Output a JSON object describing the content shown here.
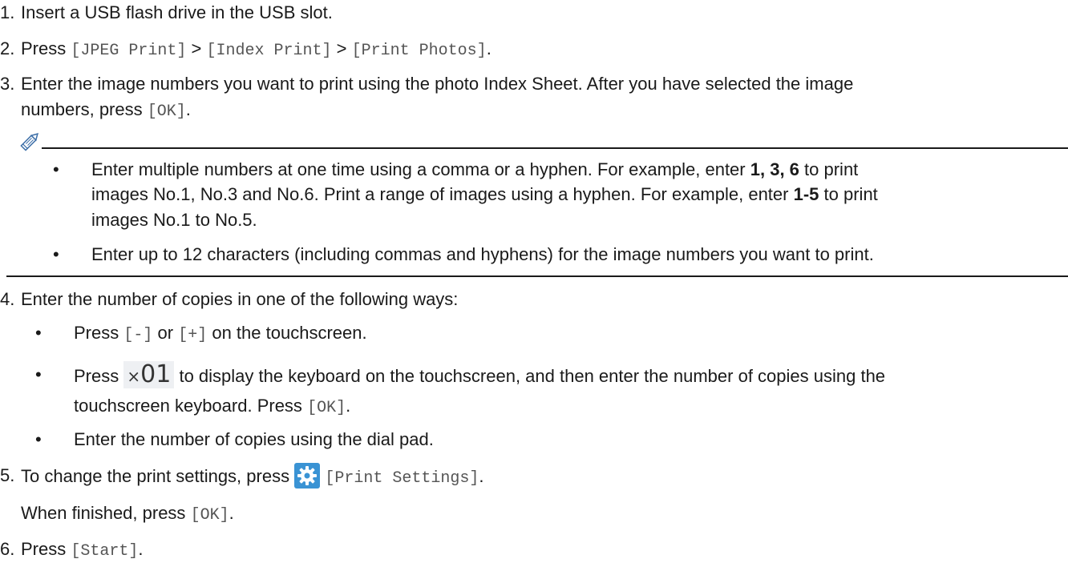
{
  "steps": [
    {
      "number": "1.",
      "text": "Insert a USB flash drive in the USB slot."
    },
    {
      "number": "2.",
      "press": "Press",
      "jpeg": "[JPEG Print]",
      "sep1": ">",
      "index": "[Index Print]",
      "sep2": ">",
      "photos": "[Print Photos]",
      "end": "."
    },
    {
      "number": "3.",
      "line1": "Enter the image numbers you want to print using the photo Index Sheet. After you have selected the image",
      "line2_pre": "numbers, press",
      "ok": "[OK]",
      "end": "."
    },
    {
      "number": "4.",
      "text": "Enter the number of copies in one of the following ways:"
    },
    {
      "number": "5.",
      "pre": "To change the print settings, press",
      "settings": "[Print Settings]",
      "end": ".",
      "finished_pre": "When finished, press",
      "ok": "[OK]",
      "finished_end": "."
    },
    {
      "number": "6.",
      "pre": "Press",
      "start": "[Start]",
      "end": "."
    }
  ],
  "note": {
    "icon": "pencil-icon",
    "bullet1": {
      "l1_pre": "Enter multiple numbers at one time using a comma or a hyphen. For example, enter",
      "l1_bold": "1, 3, 6",
      "l1_post": "to print",
      "l2_pre": "images No.1, No.3 and No.6. Print a range of images using a hyphen. For example, enter",
      "l2_bold": "1-5",
      "l2_post": "to print",
      "l3": "images No.1 to No.5."
    },
    "bullet2": "Enter up to 12 characters (including commas and hyphens) for the image numbers you want to print."
  },
  "copies_options": {
    "b1_pre": "Press",
    "minus": "[-]",
    "or": "or",
    "plus": "[+]",
    "b1_post": "on the touchscreen.",
    "b2_pre": "Press",
    "copies_x": "×",
    "copies_n": "01",
    "b2_post": "to display the keyboard on the touchscreen, and then enter the number of copies using the",
    "b2_l2_pre": "touchscreen keyboard. Press",
    "b2_ok": "[OK]",
    "b2_end": ".",
    "b3": "Enter the number of copies using the dial pad."
  },
  "colors": {
    "text": "#1a1a1a",
    "mono_text": "#555555",
    "gear_bg": "#3a93d4"
  }
}
